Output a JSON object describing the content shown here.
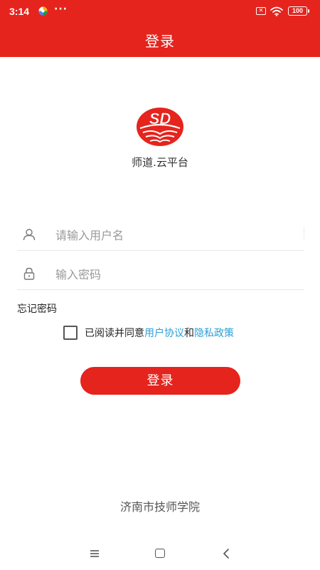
{
  "status_bar": {
    "time": "3:14",
    "dots": "···",
    "battery": "100"
  },
  "header": {
    "title": "登录"
  },
  "brand": {
    "logo_text": "SD",
    "platform_name": "师道.云平台"
  },
  "form": {
    "username_placeholder": "请输入用户名",
    "password_placeholder": "输入密码",
    "forgot_password": "忘记密码",
    "agree_prefix": "已阅读并同意",
    "user_agreement": "用户协议",
    "agree_and": "和",
    "privacy_policy": "隐私政策",
    "login_button": "登录"
  },
  "footer": {
    "school_name": "济南市技师学院"
  },
  "colors": {
    "primary": "#e5241d",
    "link": "#2a9fd6"
  }
}
